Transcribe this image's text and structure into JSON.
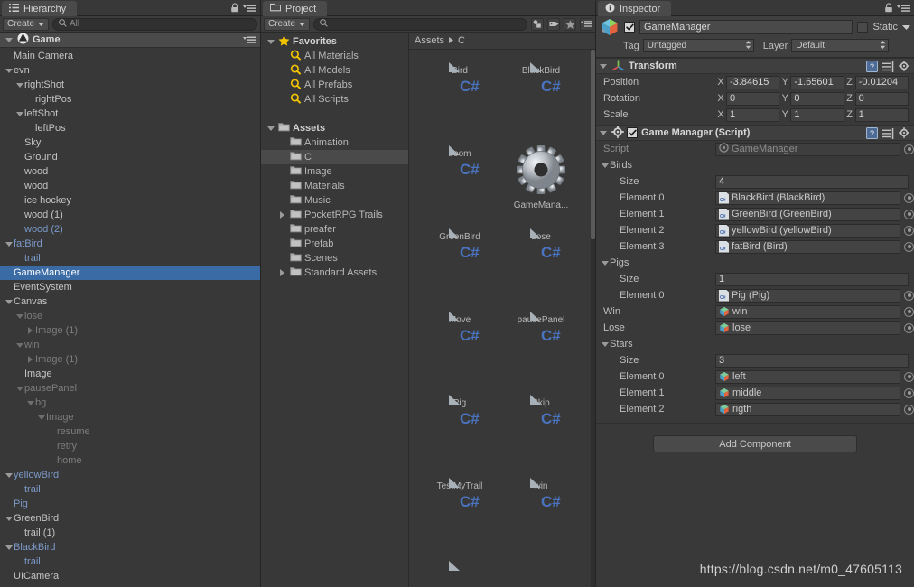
{
  "hierarchy": {
    "tab_label": "Hierarchy",
    "tab_icon": "hierarchy-icon",
    "create_label": "Create",
    "search_placeholder": "All",
    "scene_name": "Game",
    "items": [
      {
        "label": "Main Camera",
        "depth": 1,
        "arrow": "none",
        "style": "normal"
      },
      {
        "label": "evn",
        "depth": 1,
        "arrow": "down",
        "style": "normal"
      },
      {
        "label": "rightShot",
        "depth": 2,
        "arrow": "down",
        "style": "normal"
      },
      {
        "label": "rightPos",
        "depth": 3,
        "arrow": "none",
        "style": "normal"
      },
      {
        "label": "leftShot",
        "depth": 2,
        "arrow": "down",
        "style": "normal"
      },
      {
        "label": "leftPos",
        "depth": 3,
        "arrow": "none",
        "style": "normal"
      },
      {
        "label": "Sky",
        "depth": 2,
        "arrow": "none",
        "style": "normal"
      },
      {
        "label": "Ground",
        "depth": 2,
        "arrow": "none",
        "style": "normal"
      },
      {
        "label": "wood",
        "depth": 2,
        "arrow": "none",
        "style": "normal"
      },
      {
        "label": "wood",
        "depth": 2,
        "arrow": "none",
        "style": "normal"
      },
      {
        "label": "ice hockey",
        "depth": 2,
        "arrow": "none",
        "style": "normal"
      },
      {
        "label": "wood (1)",
        "depth": 2,
        "arrow": "none",
        "style": "normal"
      },
      {
        "label": "wood (2)",
        "depth": 2,
        "arrow": "none",
        "style": "prefab"
      },
      {
        "label": "fatBird",
        "depth": 1,
        "arrow": "down",
        "style": "prefab"
      },
      {
        "label": "trail",
        "depth": 2,
        "arrow": "none",
        "style": "prefab"
      },
      {
        "label": "GameManager",
        "depth": 1,
        "arrow": "none",
        "style": "selected"
      },
      {
        "label": "EventSystem",
        "depth": 1,
        "arrow": "none",
        "style": "normal"
      },
      {
        "label": "Canvas",
        "depth": 1,
        "arrow": "down",
        "style": "normal"
      },
      {
        "label": "lose",
        "depth": 2,
        "arrow": "down",
        "style": "inactive"
      },
      {
        "label": "Image (1)",
        "depth": 3,
        "arrow": "right",
        "style": "inactive"
      },
      {
        "label": "win",
        "depth": 2,
        "arrow": "down",
        "style": "inactive"
      },
      {
        "label": "Image (1)",
        "depth": 3,
        "arrow": "right",
        "style": "inactive"
      },
      {
        "label": "Image",
        "depth": 2,
        "arrow": "none",
        "style": "normal"
      },
      {
        "label": "pausePanel",
        "depth": 2,
        "arrow": "down",
        "style": "inactive"
      },
      {
        "label": "bg",
        "depth": 3,
        "arrow": "down",
        "style": "inactive"
      },
      {
        "label": "Image",
        "depth": 4,
        "arrow": "down",
        "style": "inactive"
      },
      {
        "label": "resume",
        "depth": 5,
        "arrow": "none",
        "style": "inactive"
      },
      {
        "label": "retry",
        "depth": 5,
        "arrow": "none",
        "style": "inactive"
      },
      {
        "label": "home",
        "depth": 5,
        "arrow": "none",
        "style": "inactive"
      },
      {
        "label": "yellowBird",
        "depth": 1,
        "arrow": "down",
        "style": "prefab"
      },
      {
        "label": "trail",
        "depth": 2,
        "arrow": "none",
        "style": "prefab"
      },
      {
        "label": "Pig",
        "depth": 1,
        "arrow": "none",
        "style": "prefab"
      },
      {
        "label": "GreenBird",
        "depth": 1,
        "arrow": "down",
        "style": "normal"
      },
      {
        "label": "trail (1)",
        "depth": 2,
        "arrow": "none",
        "style": "normal"
      },
      {
        "label": "BlackBird",
        "depth": 1,
        "arrow": "down",
        "style": "prefab"
      },
      {
        "label": "trail",
        "depth": 2,
        "arrow": "none",
        "style": "prefab"
      },
      {
        "label": "UICamera",
        "depth": 1,
        "arrow": "none",
        "style": "normal"
      }
    ]
  },
  "project": {
    "tab_label": "Project",
    "tab_icon": "folder-icon",
    "create_label": "Create",
    "search_placeholder": "",
    "filter_icons": [
      "asset-type-filter-icon",
      "label-filter-icon",
      "favorite-filter-icon"
    ],
    "tree": [
      {
        "label": "Favorites",
        "depth": 0,
        "arrow": "down",
        "icon": "star-icon",
        "header": true,
        "selected": false
      },
      {
        "label": "All Materials",
        "depth": 1,
        "arrow": "none",
        "icon": "search-icon",
        "header": false,
        "selected": false
      },
      {
        "label": "All Models",
        "depth": 1,
        "arrow": "none",
        "icon": "search-icon",
        "header": false,
        "selected": false
      },
      {
        "label": "All Prefabs",
        "depth": 1,
        "arrow": "none",
        "icon": "search-icon",
        "header": false,
        "selected": false
      },
      {
        "label": "All Scripts",
        "depth": 1,
        "arrow": "none",
        "icon": "search-icon",
        "header": false,
        "selected": false
      },
      {
        "label": "",
        "depth": 0,
        "arrow": "none",
        "icon": "none",
        "header": false,
        "selected": false
      },
      {
        "label": "Assets",
        "depth": 0,
        "arrow": "down",
        "icon": "folder-icon",
        "header": true,
        "selected": false
      },
      {
        "label": "Animation",
        "depth": 1,
        "arrow": "none",
        "icon": "folder-icon",
        "header": false,
        "selected": false
      },
      {
        "label": "C",
        "depth": 1,
        "arrow": "none",
        "icon": "folder-icon",
        "header": false,
        "selected": true
      },
      {
        "label": "Image",
        "depth": 1,
        "arrow": "none",
        "icon": "folder-icon",
        "header": false,
        "selected": false
      },
      {
        "label": "Materials",
        "depth": 1,
        "arrow": "none",
        "icon": "folder-icon",
        "header": false,
        "selected": false
      },
      {
        "label": "Music",
        "depth": 1,
        "arrow": "none",
        "icon": "folder-icon",
        "header": false,
        "selected": false
      },
      {
        "label": "PocketRPG Trails",
        "depth": 1,
        "arrow": "right",
        "icon": "folder-icon",
        "header": false,
        "selected": false
      },
      {
        "label": "preafer",
        "depth": 1,
        "arrow": "none",
        "icon": "folder-icon",
        "header": false,
        "selected": false
      },
      {
        "label": "Prefab",
        "depth": 1,
        "arrow": "none",
        "icon": "folder-icon",
        "header": false,
        "selected": false
      },
      {
        "label": "Scenes",
        "depth": 1,
        "arrow": "none",
        "icon": "folder-icon",
        "header": false,
        "selected": false
      },
      {
        "label": "Standard Assets",
        "depth": 1,
        "arrow": "right",
        "icon": "folder-icon",
        "header": false,
        "selected": false
      }
    ],
    "breadcrumb": [
      "Assets",
      "C"
    ],
    "assets": [
      {
        "name": "Bird",
        "icon": "csharp-script-icon"
      },
      {
        "name": "BlackBird",
        "icon": "csharp-script-icon"
      },
      {
        "name": "boom",
        "icon": "csharp-script-icon"
      },
      {
        "name": "GameMana...",
        "icon": "gear-asset-icon"
      },
      {
        "name": "GreenBird",
        "icon": "csharp-script-icon"
      },
      {
        "name": "Lose",
        "icon": "csharp-script-icon"
      },
      {
        "name": "Move",
        "icon": "csharp-script-icon"
      },
      {
        "name": "pausePanel",
        "icon": "csharp-script-icon"
      },
      {
        "name": "Pig",
        "icon": "csharp-script-icon"
      },
      {
        "name": "Skip",
        "icon": "csharp-script-icon"
      },
      {
        "name": "TestMyTrail",
        "icon": "csharp-script-icon"
      },
      {
        "name": "win",
        "icon": "csharp-script-icon"
      },
      {
        "name": "",
        "icon": "blank-file-icon"
      }
    ]
  },
  "inspector": {
    "tab_label": "Inspector",
    "tab_icon": "info-icon",
    "object_name": "GameManager",
    "object_enabled": true,
    "static_label": "Static",
    "static_checked": false,
    "tag_label": "Tag",
    "tag_value": "Untagged",
    "layer_label": "Layer",
    "layer_value": "Default",
    "transform": {
      "title": "Transform",
      "icon": "transform-axis-icon",
      "rows": [
        {
          "label": "Position",
          "x": "-3.84615",
          "y": "-1.65601",
          "z": "-0.01204"
        },
        {
          "label": "Rotation",
          "x": "0",
          "y": "0",
          "z": "0"
        },
        {
          "label": "Scale",
          "x": "1",
          "y": "1",
          "z": "1"
        }
      ],
      "axes": [
        "X",
        "Y",
        "Z"
      ]
    },
    "script_component": {
      "title": "Game Manager (Script)",
      "icon": "script-gear-icon",
      "enabled": true,
      "script_label": "Script",
      "script_value": "GameManager",
      "arrays": [
        {
          "name": "Birds",
          "size_label": "Size",
          "size_value": "4",
          "elements": [
            {
              "label": "Element 0",
              "value": "BlackBird (BlackBird)",
              "icon": "script-ref-icon"
            },
            {
              "label": "Element 1",
              "value": "GreenBird (GreenBird)",
              "icon": "script-ref-icon"
            },
            {
              "label": "Element 2",
              "value": "yellowBird (yellowBird)",
              "icon": "script-ref-icon"
            },
            {
              "label": "Element 3",
              "value": "fatBird (Bird)",
              "icon": "script-ref-icon"
            }
          ]
        },
        {
          "name": "Pigs",
          "size_label": "Size",
          "size_value": "1",
          "elements": [
            {
              "label": "Element 0",
              "value": "Pig (Pig)",
              "icon": "script-ref-icon"
            }
          ]
        }
      ],
      "singles": [
        {
          "label": "Win",
          "value": "win",
          "icon": "gameobject-cube-icon"
        },
        {
          "label": "Lose",
          "value": "lose",
          "icon": "gameobject-cube-icon"
        }
      ],
      "stars": {
        "name": "Stars",
        "size_label": "Size",
        "size_value": "3",
        "elements": [
          {
            "label": "Element 0",
            "value": "left",
            "icon": "gameobject-cube-icon"
          },
          {
            "label": "Element 1",
            "value": "middle",
            "icon": "gameobject-cube-icon"
          },
          {
            "label": "Element 2",
            "value": "rigth",
            "icon": "gameobject-cube-icon"
          }
        ]
      }
    },
    "add_component_label": "Add Component"
  },
  "watermark": "https://blog.csdn.net/m0_47605113",
  "colors": {
    "panel_bg": "#383838",
    "selection_blue": "#3a6ba5",
    "prefab_text": "#7b9ac9",
    "inactive_text": "#7d7d7d",
    "csharp_blue": "#4a73bf",
    "favorites_star": "#f2c400"
  }
}
